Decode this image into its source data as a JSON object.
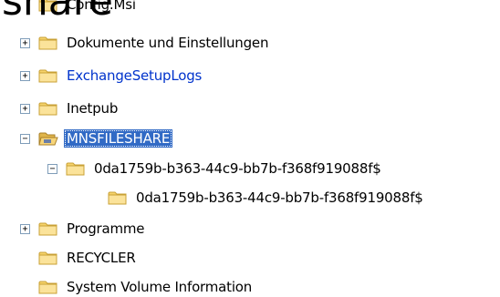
{
  "heading_fragment": "share",
  "tree": {
    "items": [
      {
        "label": "Config.Msi",
        "toggle": "none"
      },
      {
        "label": "Dokumente und Einstellungen",
        "toggle": "+"
      },
      {
        "label": "ExchangeSetupLogs",
        "toggle": "+"
      },
      {
        "label": "Inetpub",
        "toggle": "+"
      },
      {
        "label": "MNSFILESHARE",
        "toggle": "−",
        "selected": true
      },
      {
        "label": "0da1759b-b363-44c9-bb7b-f368f919088f$",
        "toggle": "−"
      },
      {
        "label": "0da1759b-b363-44c9-bb7b-f368f919088f$",
        "toggle": "none"
      },
      {
        "label": "Programme",
        "toggle": "+"
      },
      {
        "label": "RECYCLER",
        "toggle": "none"
      },
      {
        "label": "System Volume Information",
        "toggle": "none"
      }
    ]
  },
  "colors": {
    "selection": "#316ac5",
    "link": "#0033cc",
    "folder": "#f6d36b"
  },
  "icons": {
    "folder": "folder-icon",
    "folder_open": "folder-open-icon",
    "expand": "plus-box-icon",
    "collapse": "minus-box-icon"
  }
}
